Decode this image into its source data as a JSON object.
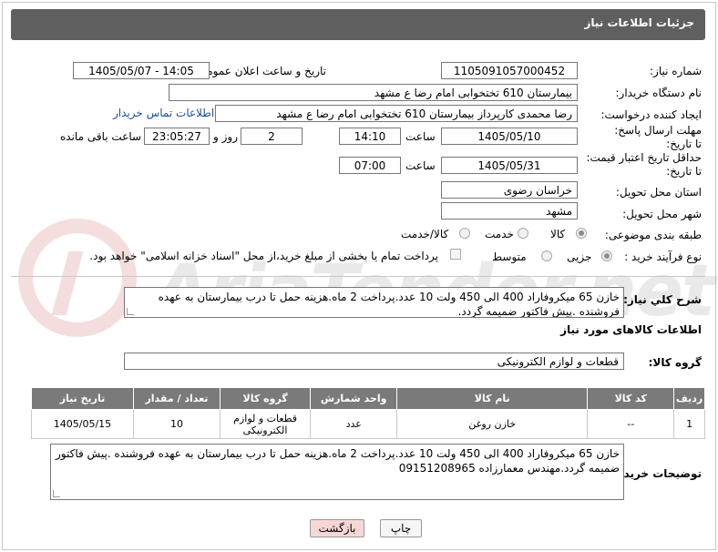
{
  "header": {
    "title": "جزئیات اطلاعات نیاز"
  },
  "fields": {
    "need_number_label": "شماره نیاز:",
    "need_number": "1105091057000452",
    "announce_label": "تاریخ و ساعت اعلان عمومی:",
    "announce_value": "1405/05/07 - 14:05",
    "buyer_org_label": "نام دستگاه خریدار:",
    "buyer_org": "بیمارستان 610 تختخوابی امام رضا ع  مشهد",
    "creator_label": "ایجاد کننده درخواست:",
    "creator": "رضا محمدی کارپرداز بیمارستان 610 تختخوابی امام رضا ع  مشهد",
    "contact_link": "اطلاعات تماس خریدار",
    "reply_deadline_label": "مهلت ارسال پاسخ: تا تاریخ:",
    "reply_date": "1405/05/10",
    "time_label": "ساعت",
    "reply_time": "14:10",
    "days": "2",
    "days_label": "روز و",
    "remaining": "23:05:27",
    "remaining_label": "ساعت باقی مانده",
    "validity_label": "حداقل تاریخ اعتبار قیمت: تا تاریخ:",
    "validity_date": "1405/05/31",
    "validity_time_label": "ساعت",
    "validity_time": "07:00",
    "province_label": "استان محل تحویل:",
    "province": "خراسان رضوی",
    "city_label": "شهر محل تحویل:",
    "city": "مشهد",
    "category_label": "طبقه بندی موضوعی:",
    "category_options": [
      "کالا",
      "خدمت",
      "کالا/خدمت"
    ],
    "process_label": "نوع فرآیند خرید :",
    "process_options": [
      "جزیی",
      "متوسط"
    ],
    "payment_note": "پرداخت تمام یا بخشی از مبلغ خرید،از محل \"اسناد خزانه اسلامی\" خواهد بود."
  },
  "description": {
    "label": "شرح کلي نياز:",
    "text": "خازن 65 میکروفاراد 400 الی 450 ولت 10 عدد.پرداخت 2 ماه.هزینه حمل تا درب بیمارستان به عهده فروشنده .پیش فاکتور ضمیمه گردد."
  },
  "goods_section": {
    "title": "اطلاعات کالاهای مورد نیاز",
    "group_label": "گروه کالا:",
    "group_value": "قطعات و لوازم الکترونیکی"
  },
  "table": {
    "headers": [
      "ردیف",
      "کد کالا",
      "نام کالا",
      "واحد شمارش",
      "گروه کالا",
      "تعداد / مقدار",
      "تاریخ نیاز"
    ],
    "rows": [
      [
        "1",
        "--",
        "خازن روغن",
        "عدد",
        "قطعات و لوازم الکترونیکی",
        "10",
        "1405/05/15"
      ]
    ]
  },
  "buyer_notes": {
    "label": "توضیحات خریدار:",
    "text": "خازن 65 میکروفاراد 400 الی 450 ولت 10 عدد.پرداخت 2 ماه.هزینه حمل تا درب بیمارستان به عهده فروشنده .پیش فاکتور ضمیمه گردد.مهندس معمارزاده 09151208965"
  },
  "buttons": {
    "print": "چاپ",
    "back": "بازگشت"
  },
  "watermark": "AriaTender.net",
  "colors": {
    "title_bar": "#5f5f5f",
    "table_header": "#7a7a7a",
    "link": "#1a4fa8",
    "back_button": "#f7d6d6"
  }
}
